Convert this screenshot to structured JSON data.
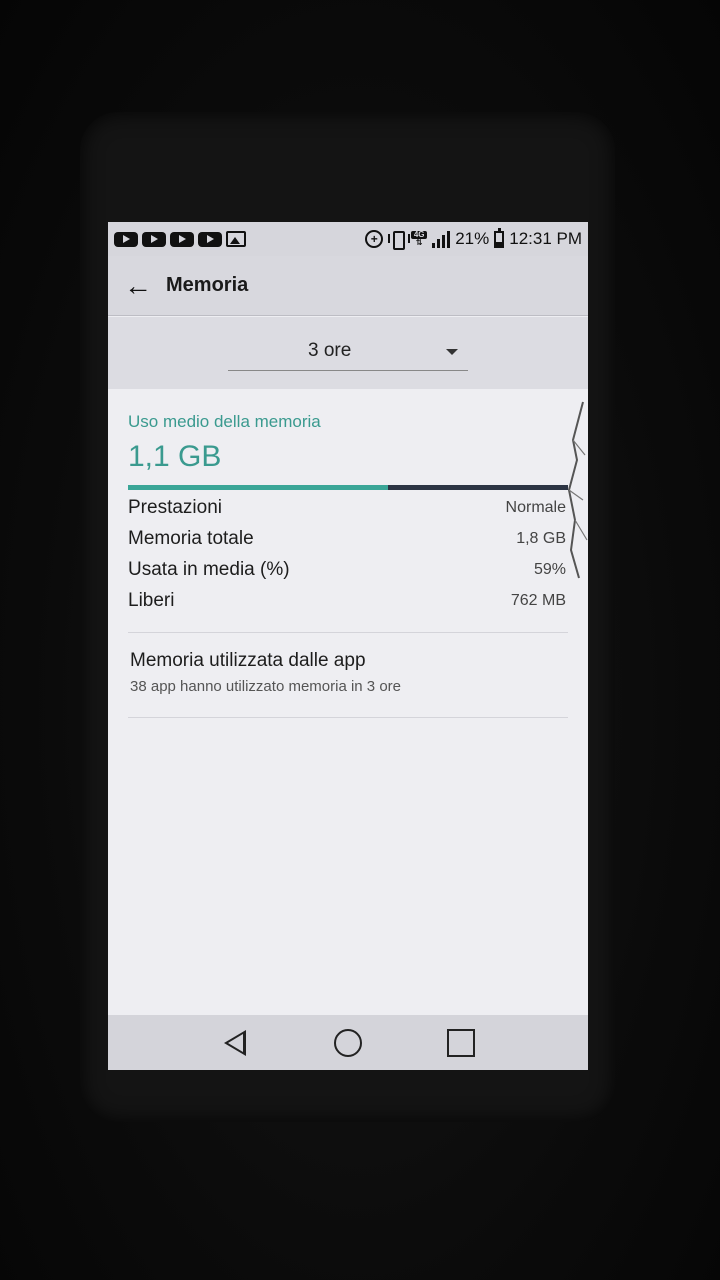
{
  "status_bar": {
    "notifications": [
      "youtube-icon",
      "youtube-icon",
      "youtube-icon",
      "youtube-icon",
      "image-icon"
    ],
    "network": "4G",
    "battery_percent": "21%",
    "time": "12:31 PM"
  },
  "app_bar": {
    "title": "Memoria"
  },
  "period_select": {
    "value": "3 ore"
  },
  "memory": {
    "avg_label": "Uso medio della memoria",
    "avg_value": "1,1 GB",
    "usage_fraction": 0.59,
    "stats": [
      {
        "label": "Prestazioni",
        "value": "Normale"
      },
      {
        "label": "Memoria totale",
        "value": "1,8 GB"
      },
      {
        "label": "Usata in media (%)",
        "value": "59%"
      },
      {
        "label": "Liberi",
        "value": "762 MB"
      }
    ]
  },
  "apps_item": {
    "title": "Memoria utilizzata dalle app",
    "subtitle": "38 app hanno utilizzato memoria in 3 ore"
  },
  "colors": {
    "accent": "#3a9a8f",
    "bar_track": "#2c3444"
  }
}
